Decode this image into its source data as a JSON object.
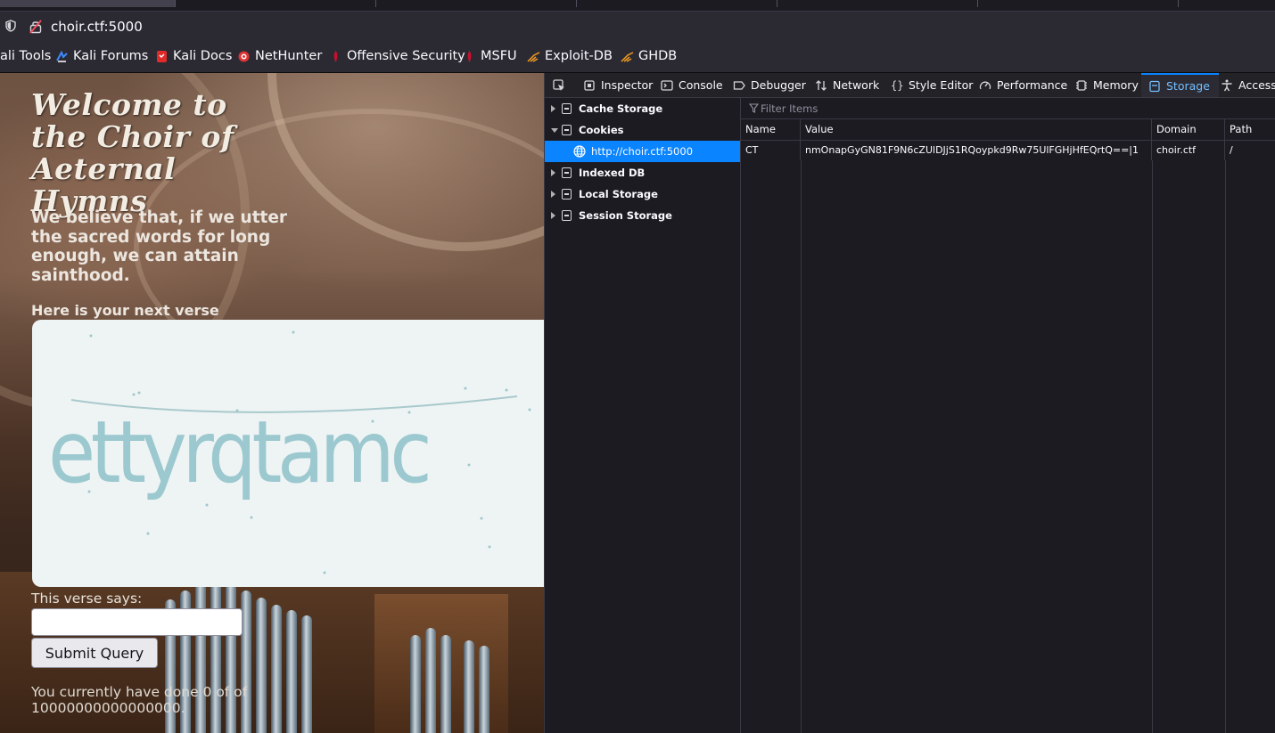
{
  "browser": {
    "url": "choir.ctf:5000",
    "bookmarks": [
      {
        "label": "ali Tools",
        "icon": "kali-icon"
      },
      {
        "label": "Kali Forums",
        "icon": "kali-forums-icon"
      },
      {
        "label": "Kali Docs",
        "icon": "kali-docs-icon"
      },
      {
        "label": "NetHunter",
        "icon": "nethunter-icon"
      },
      {
        "label": "Offensive Security",
        "icon": "offsec-icon"
      },
      {
        "label": "MSFU",
        "icon": "msfu-icon"
      },
      {
        "label": "Exploit-DB",
        "icon": "exploitdb-icon"
      },
      {
        "label": "GHDB",
        "icon": "ghdb-icon"
      }
    ]
  },
  "page": {
    "title": "Welcome to the Choir of Aeternal Hymns",
    "belief": "We believe that, if we utter the sacred words for long enough, we can attain sainthood.",
    "verse_heading": "Here is your next verse",
    "captcha_text": "ettyrqtamc",
    "verse_label": "This verse says:",
    "input_value": "",
    "submit_label": "Submit Query",
    "progress": "You currently have done 0 of of 10000000000000000."
  },
  "devtools": {
    "tabs": [
      {
        "label": "Inspector",
        "icon": "inspector-icon"
      },
      {
        "label": "Console",
        "icon": "console-icon"
      },
      {
        "label": "Debugger",
        "icon": "debugger-icon"
      },
      {
        "label": "Network",
        "icon": "network-icon"
      },
      {
        "label": "Style Editor",
        "icon": "style-editor-icon"
      },
      {
        "label": "Performance",
        "icon": "performance-icon"
      },
      {
        "label": "Memory",
        "icon": "memory-icon"
      },
      {
        "label": "Storage",
        "icon": "storage-icon",
        "selected": true
      },
      {
        "label": "Accessi",
        "icon": "accessibility-icon"
      }
    ],
    "tree": [
      {
        "label": "Cache Storage",
        "expanded": false
      },
      {
        "label": "Cookies",
        "expanded": true
      },
      {
        "label": "http://choir.ctf:5000",
        "selected": true
      },
      {
        "label": "Indexed DB",
        "expanded": false
      },
      {
        "label": "Local Storage",
        "expanded": false
      },
      {
        "label": "Session Storage",
        "expanded": false
      }
    ],
    "filter_placeholder": "Filter Items",
    "columns": [
      "Name",
      "Value",
      "Domain",
      "Path"
    ],
    "rows": [
      {
        "name": "CT",
        "value": "nmOnapGyGN81F9N6cZUlDJjS1RQoypkd9Rw75UlFGHjHfEQrtQ==|1",
        "domain": "choir.ctf",
        "path": "/"
      }
    ],
    "colors": {
      "accent": "#0a84ff",
      "selected_tab_text": "#75bfff"
    }
  }
}
